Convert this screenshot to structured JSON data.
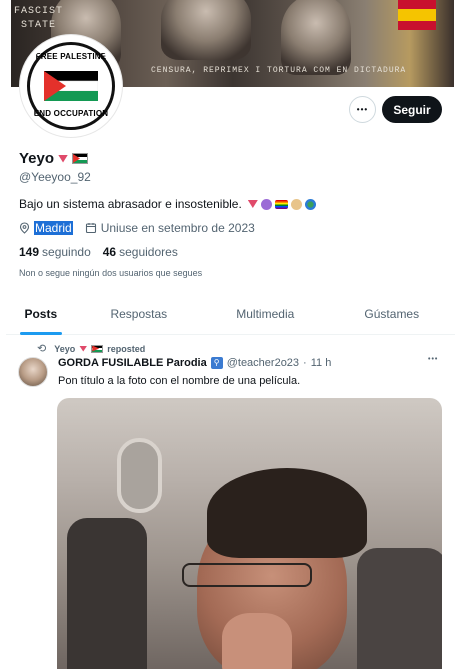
{
  "banner": {
    "wall_text_1": "FASCIST",
    "wall_text_2": "STATE",
    "wall_text_3": "CENSURA, REPRIMEX I TORTURA COM EN DICTADURA"
  },
  "avatar": {
    "top_text": "FREE PALESTINE",
    "bottom_text": "END OCCUPATION"
  },
  "actions": {
    "more_symbol": "•••",
    "follow_label": "Seguir"
  },
  "profile": {
    "display_name": "Yeyo",
    "handle": "@Yeeyoo_92",
    "bio_text": "Bajo un sistema abrasador e insostenible.",
    "location": "Madrid",
    "joined": "Uniuse en setembro de 2023",
    "following_count": "149",
    "following_label": "seguindo",
    "followers_count": "46",
    "followers_label": "seguidores",
    "not_followed_note": "Non o segue ningún dos usuarios que segues"
  },
  "tabs": [
    {
      "label": "Posts",
      "active": true
    },
    {
      "label": "Respostas",
      "active": false
    },
    {
      "label": "Multimedia",
      "active": false
    },
    {
      "label": "Gústames",
      "active": false
    }
  ],
  "post": {
    "reposter": "Yeyo",
    "repost_label": "reposted",
    "author": "GORDA FUSILABLE Parodia",
    "author_handle": "@teacher2o23",
    "separator": "·",
    "time": "11 h",
    "more_symbol": "•••",
    "text": "Pon título a la foto con el nombre de una película."
  },
  "icons": {
    "location": "location-pin-icon",
    "calendar": "calendar-icon",
    "repost": "repost-icon",
    "more": "more-horizontal-icon"
  },
  "colors": {
    "accent": "#1d9bf0",
    "follow_bg": "#0f1419",
    "selection": "#1d6fd6"
  }
}
